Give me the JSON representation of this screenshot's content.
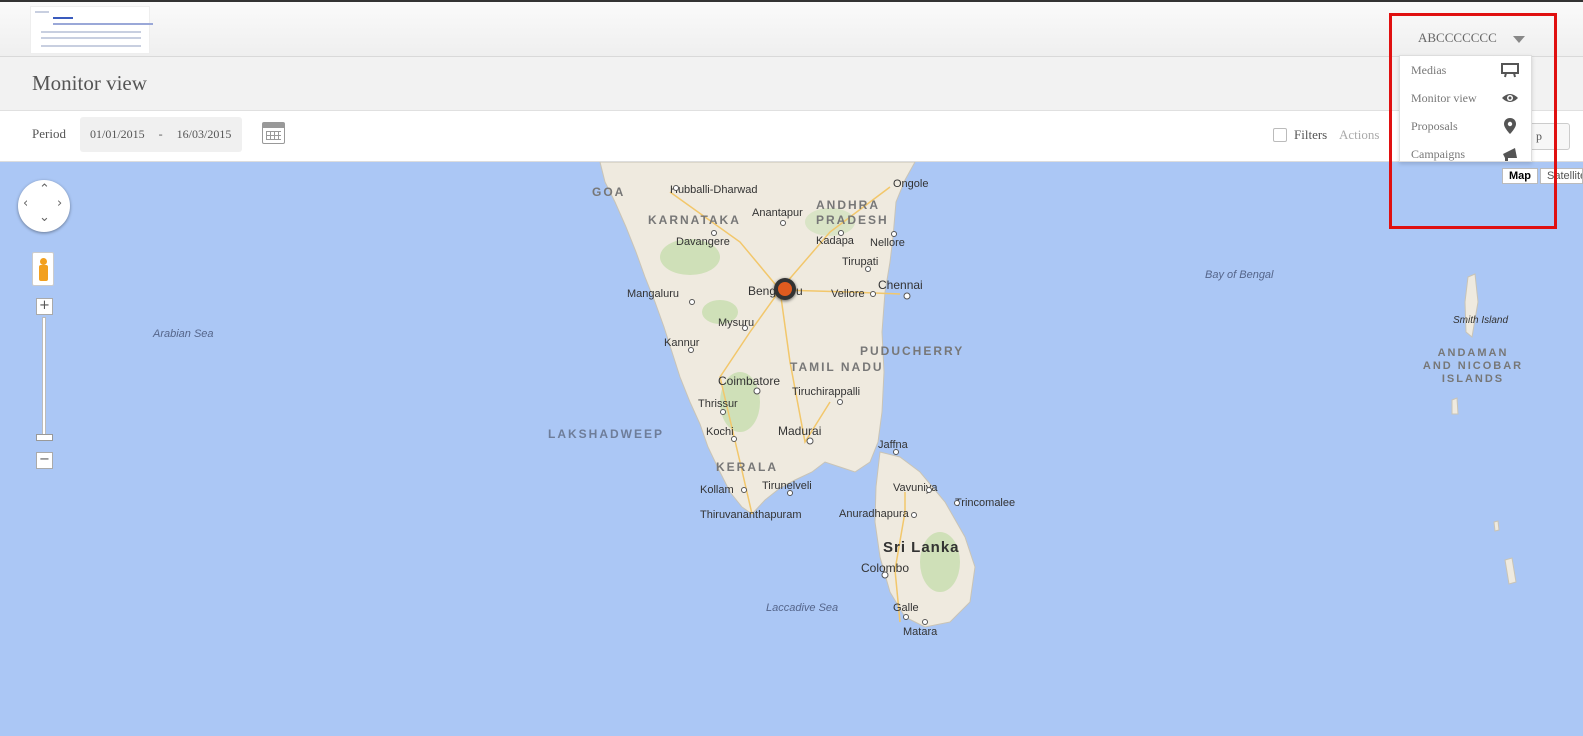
{
  "header": {
    "user_name": "ABCCCCCCC"
  },
  "page": {
    "title": "Monitor view"
  },
  "filterbar": {
    "period_label": "Period",
    "date_from": "01/01/2015",
    "date_separator": "-",
    "date_to": "16/03/2015",
    "filters_label": "Filters",
    "actions_label": "Actions",
    "hidden_button_text": "p"
  },
  "user_dropdown": {
    "items": [
      {
        "label": "Medias",
        "icon": "monitor-icon"
      },
      {
        "label": "Monitor view",
        "icon": "eye-icon"
      },
      {
        "label": "Proposals",
        "icon": "map-pin-icon"
      },
      {
        "label": "Campaigns",
        "icon": "megaphone-icon"
      }
    ]
  },
  "map": {
    "type_buttons": {
      "map": "Map",
      "satellite": "Satellite"
    },
    "controls": {
      "zoom_in": "+",
      "zoom_out": "−"
    },
    "labels": {
      "goa": "GOA",
      "hubballi": "Hubballi-Dharwad",
      "karnataka": "KARNATAKA",
      "anantapur": "Anantapur",
      "andhra": "ANDHRA PRADESH",
      "ongole": "Ongole",
      "ongole_n": "Ongole",
      "davangere": "Davangere",
      "kadapa": "Kadapa",
      "nellore": "Nellore",
      "tirupati": "Tirupati",
      "mangaluru": "Mangaluru",
      "bengaluru": "Bengaluru",
      "vellore": "Vellore",
      "chennai": "Chennai",
      "mysuru": "Mysuru",
      "kannur": "Kannur",
      "puducherry": "PUDUCHERRY",
      "tamilnadu": "TAMIL NADU",
      "coimbatore": "Coimbatore",
      "thrissur": "Thrissur",
      "tiruchirappalli": "Tiruchirappalli",
      "kochi": "Kochi",
      "madurai": "Madurai",
      "jaffna": "Jaffna",
      "kerala": "KERALA",
      "tirunelveli": "Tirunelveli",
      "vavuniya": "Vavuniya",
      "kollam": "Kollam",
      "trincomalee": "Trincomalee",
      "thiruvananthapuram": "Thiruvananthapuram",
      "anuradhapura": "Anuradhapura",
      "srilanka": "Sri Lanka",
      "colombo": "Colombo",
      "galle": "Galle",
      "matara": "Matara",
      "lakshadweep": "LAKSHADWEEP",
      "arabian_sea": "Arabian Sea",
      "laccadive_sea": "Laccadive Sea",
      "bay_of_bengal": "Bay of Bengal",
      "smith_island": "Smith Island",
      "andaman": "ANDAMAN\nAND NICOBAR\nISLANDS"
    }
  }
}
